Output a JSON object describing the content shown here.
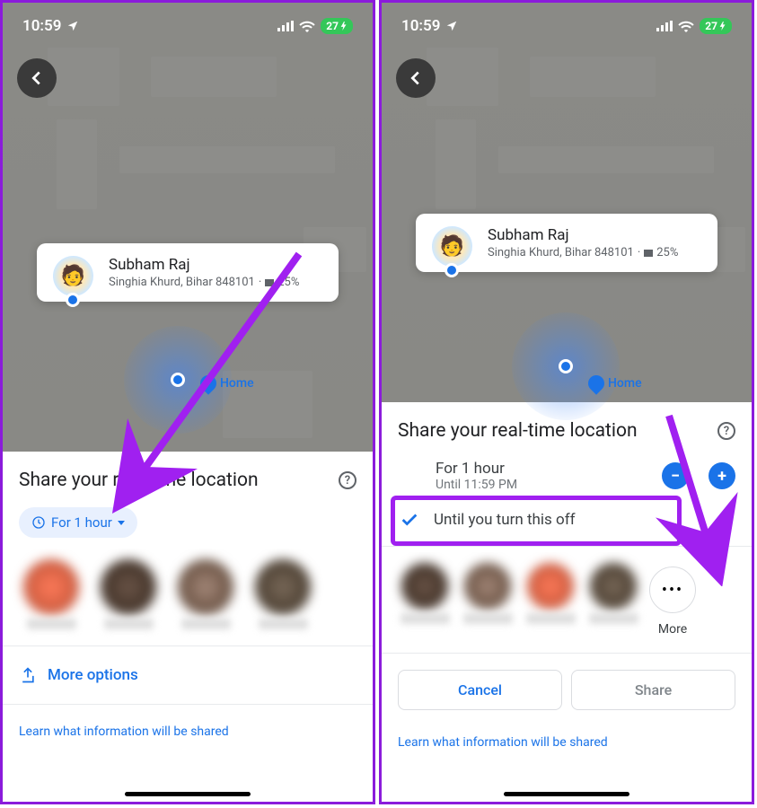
{
  "status": {
    "time": "10:59",
    "battery": "27"
  },
  "user_card": {
    "name": "Subham Raj",
    "location": "Singhia Khurd, Bihar 848101",
    "battery_pct": "25%"
  },
  "home_label": "Home",
  "panel": {
    "title": "Share your real-time location"
  },
  "left": {
    "duration_chip": "For 1 hour",
    "more_options": "More options"
  },
  "right": {
    "row1_label": "For 1 hour",
    "row1_sub": "Until 11:59 PM",
    "row2_label": "Until you turn this off",
    "more_label": "More",
    "cancel": "Cancel",
    "share": "Share"
  },
  "learn_link": "Learn what information will be shared"
}
